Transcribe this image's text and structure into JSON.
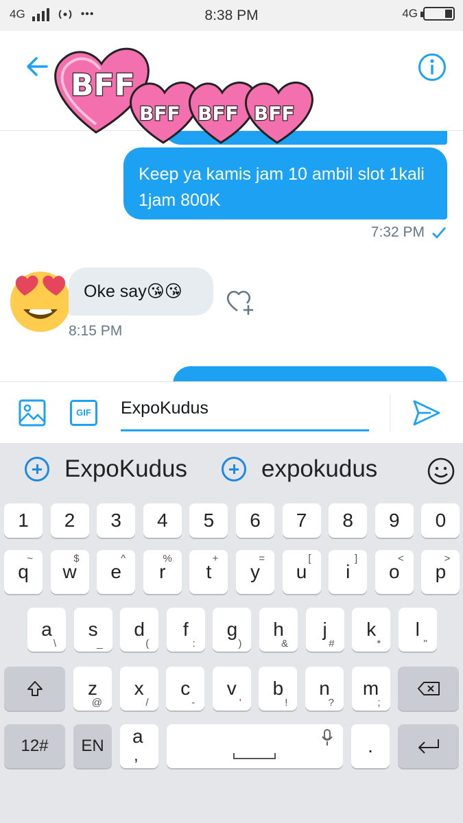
{
  "status_bar": {
    "network": "4G",
    "time": "8:38 PM",
    "network_right": "4G",
    "more": "•••"
  },
  "header": {
    "back_icon": "arrow-left-icon",
    "info_icon": "info-circle-icon",
    "sticker_texts": [
      "BFF",
      "BFF",
      "BFF",
      "BFF"
    ],
    "accent": "#1da1f2"
  },
  "messages": [
    {
      "direction": "out",
      "text": "Keep ya kamis jam 10 ambil slot 1kali 1jam 800K",
      "time": "7:32 PM",
      "read_icon": "check-icon"
    },
    {
      "direction": "in",
      "text": "Oke say😘😘",
      "time": "8:15 PM"
    }
  ],
  "composer": {
    "gif_label": "GIF",
    "input_value": "ExpoKudus",
    "send_icon": "send-icon",
    "media_icon": "image-icon"
  },
  "keyboard": {
    "suggestions": [
      "ExpoKudus",
      "expokudus"
    ],
    "emoji_icon": "smiley-icon",
    "number_row": [
      "1",
      "2",
      "3",
      "4",
      "5",
      "6",
      "7",
      "8",
      "9",
      "0"
    ],
    "row1": [
      {
        "k": "q",
        "s": "~"
      },
      {
        "k": "w",
        "s": "$"
      },
      {
        "k": "e",
        "s": "^"
      },
      {
        "k": "r",
        "s": "%"
      },
      {
        "k": "t",
        "s": "+"
      },
      {
        "k": "y",
        "s": "="
      },
      {
        "k": "u",
        "s": "["
      },
      {
        "k": "i",
        "s": "]"
      },
      {
        "k": "o",
        "s": "<"
      },
      {
        "k": "p",
        "s": ">"
      }
    ],
    "row2": [
      {
        "k": "a",
        "s": "\\"
      },
      {
        "k": "s",
        "s": "_"
      },
      {
        "k": "d",
        "s": "("
      },
      {
        "k": "f",
        "s": ":"
      },
      {
        "k": "g",
        "s": ")"
      },
      {
        "k": "h",
        "s": "&"
      },
      {
        "k": "j",
        "s": "#"
      },
      {
        "k": "k",
        "s": "*"
      },
      {
        "k": "l",
        "s": "\""
      }
    ],
    "row3": [
      {
        "k": "z",
        "s": "@"
      },
      {
        "k": "x",
        "s": "/"
      },
      {
        "k": "c",
        "s": "-"
      },
      {
        "k": "v",
        "s": "'"
      },
      {
        "k": "b",
        "s": "!"
      },
      {
        "k": "n",
        "s": "?"
      },
      {
        "k": "m",
        "s": ";"
      }
    ],
    "bottom": {
      "symbols_label": "12#",
      "lang_label": "EN",
      "punct_label": "a",
      "punct_sub": ",",
      "period_label": "."
    }
  }
}
